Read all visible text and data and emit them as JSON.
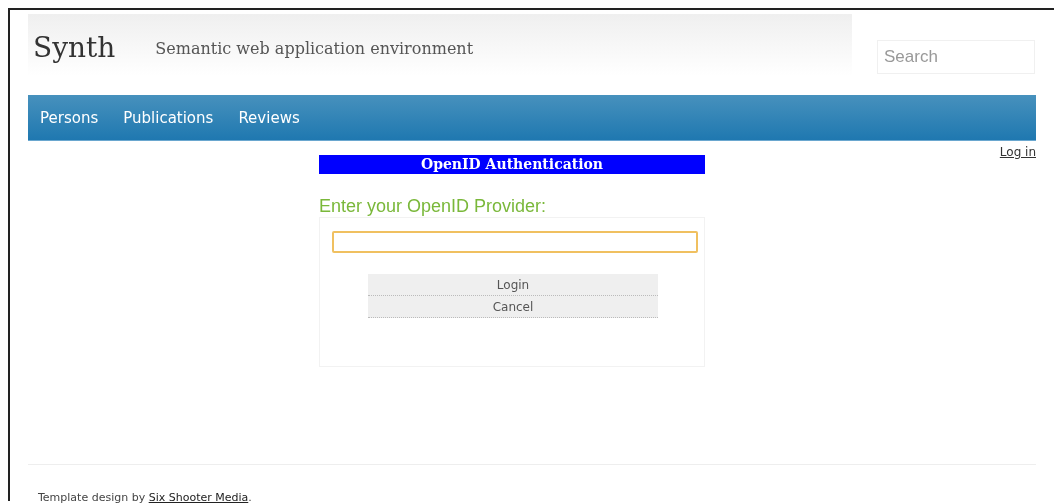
{
  "header": {
    "site_title": "Synth",
    "tagline": "Semantic web application environment"
  },
  "search": {
    "placeholder": "Search"
  },
  "nav": {
    "items": [
      {
        "label": "Persons"
      },
      {
        "label": "Publications"
      },
      {
        "label": "Reviews"
      }
    ]
  },
  "login_link": "Log in",
  "openid": {
    "title": "OpenID Authentication",
    "prompt": "Enter your OpenID Provider:",
    "provider_field": {
      "focused": true
    },
    "buttons": [
      "Login",
      "Cancel"
    ]
  },
  "footer": {
    "text_before": "Template design by ",
    "link": "Six Shooter Media",
    "text_after": "."
  }
}
